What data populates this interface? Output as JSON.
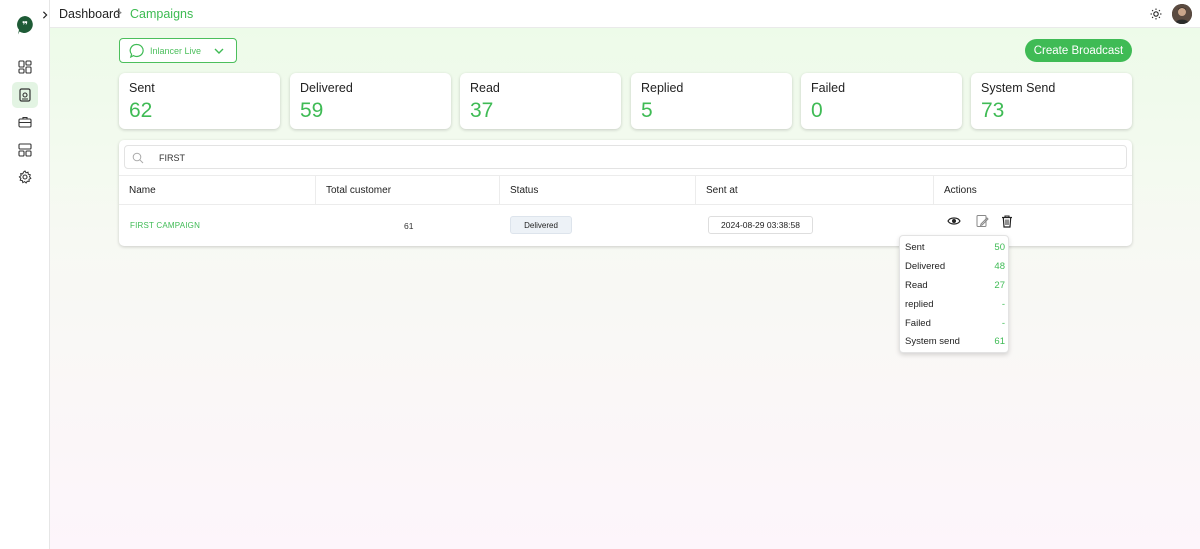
{
  "breadcrumb": {
    "home": "Dashboard",
    "separator": ">",
    "current": "Campaigns"
  },
  "account_select": {
    "label": "Inlancer Live"
  },
  "create_button": {
    "label": "Create Broadcast"
  },
  "stats": [
    {
      "label": "Sent",
      "value": "62"
    },
    {
      "label": "Delivered",
      "value": "59"
    },
    {
      "label": "Read",
      "value": "37"
    },
    {
      "label": "Replied",
      "value": "5"
    },
    {
      "label": "Failed",
      "value": "0"
    },
    {
      "label": "System Send",
      "value": "73"
    }
  ],
  "search": {
    "value": "FIRST"
  },
  "table": {
    "headers": [
      "Name",
      "Total customer",
      "Status",
      "Sent at",
      "Actions"
    ],
    "rows": [
      {
        "name": "FIRST CAMPAIGN",
        "total": "61",
        "status": "Delivered",
        "sent_at": "2024-08-29 03:38:58"
      }
    ]
  },
  "popover": {
    "rows": [
      {
        "label": "Sent",
        "value": "50"
      },
      {
        "label": "Delivered",
        "value": "48"
      },
      {
        "label": "Read",
        "value": "27"
      },
      {
        "label": "replied",
        "value": "-"
      },
      {
        "label": "Failed",
        "value": "-"
      },
      {
        "label": "System send",
        "value": "61"
      }
    ]
  },
  "icons": {
    "logo": "quote-chat-logo-icon",
    "collapse": "chevron-right-icon",
    "nav": [
      "dashboard-grid-icon",
      "campaign-book-icon",
      "briefcase-icon",
      "layout-icon",
      "gear-icon"
    ],
    "theme": "sun-icon",
    "actions": [
      "eye-icon",
      "edit-icon",
      "trash-icon"
    ]
  },
  "colors": {
    "accent": "#3fbb55",
    "logo": "#1e5b36"
  }
}
